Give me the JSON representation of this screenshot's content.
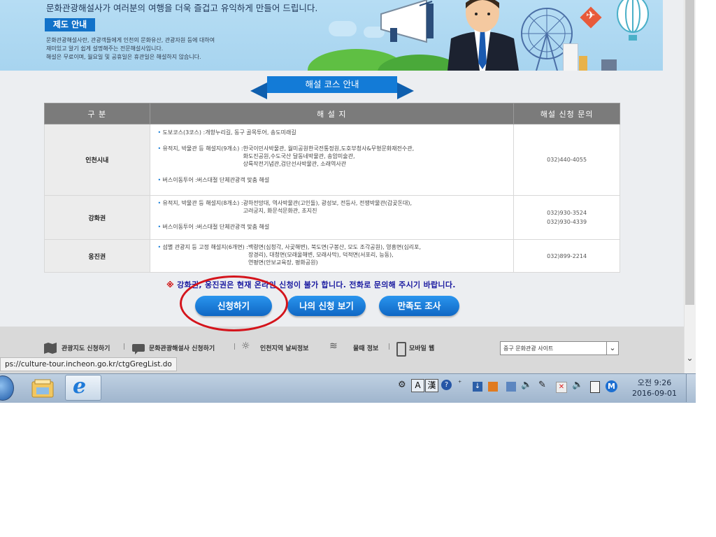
{
  "hero": {
    "tagline": "문화관광해설사가 여러분의 여행을 더욱 즐겁고 유익하게 만들어 드립니다.",
    "badge": "제도 안내",
    "desc_line1": "문화관광해설사란, 관광객들에게 인천의 문화유산, 관광자원 등에 대하여",
    "desc_line2": "재미있고 알기 쉽게 설명해주는 전문해설사입니다.",
    "desc_line3": "해설은 무료이며, 월요일 및 공휴일은 휴관일은 해설하지 않습니다."
  },
  "course_banner": "해설 코스 안내",
  "table": {
    "headers": [
      "구 분",
      "해 설 지",
      "해설 신청 문의"
    ],
    "rows": [
      {
        "region": "인천시내",
        "lines": [
          {
            "label": "도보코스(3코스) : ",
            "details": "개항누리길, 동구 골목투어, 송도미래길"
          },
          {
            "label": "유적지, 박물관 등 해설지(9개소) : ",
            "details": "한국이민사박물관, 월미공원한국전통정원,도호부청사&무형문화재전수관,\n화도진공원,수도국산 달동네박물관, 송암미술관,\n상륙작전기념관,검단선사박물관, 소래역사관"
          },
          {
            "label": "버스이동투어 : ",
            "details": "버스대절 단체관광객 맞춤 해설"
          }
        ],
        "phone": [
          "032)440-4055"
        ]
      },
      {
        "region": "강화권",
        "lines": [
          {
            "label": "유적지, 박물관 등 해설지(8개소) : ",
            "details": "광하전망대, 역사박물관(고인돌), 광성보, 전등사, 전쟁박물관(갑곶돈대),\n고려궁지, 화문석문화관, 초지진"
          },
          {
            "label": "버스이동투어 : ",
            "details": "버스대절 단체관광객 맞춤 해설"
          }
        ],
        "phone": [
          "032)930-3524",
          "032)930-4339"
        ]
      },
      {
        "region": "옹진권",
        "lines": [
          {
            "label": "섬별 관광지 등 고정 해설지(6개면) : ",
            "details": "백령면(심청각, 사곶해변), 북도면(구봉산, 모도 조각공원), 영흥면(십리포,\n장경리), 대청면(모래울해변, 모래사막), 덕적면(서포리, 능동),\n연평면(안보교육장, 평화공원)"
          }
        ],
        "phone": [
          "032)899-2214"
        ]
      }
    ]
  },
  "notice": {
    "star": "※",
    "text": "강화권, 옹진권은 현재 온라인 신청이 불가 합니다. 전화로 문의해 주시기 바랍니다."
  },
  "buttons": {
    "apply": "신청하기",
    "my_apply": "나의 신청 보기",
    "survey": "만족도 조사"
  },
  "footer": {
    "links": [
      "관광지도 신청하기",
      "문화관광해설사 신청하기",
      "인천지역 날씨정보",
      "물때 정보",
      "모바일 웹"
    ],
    "select_value": "중구 문화관광 사이트"
  },
  "status_url": "ps://culture-tour.incheon.go.kr/ctgGregList.do",
  "tray": {
    "ime_a": "A",
    "ime_han": "漢",
    "time": "오전 9:26",
    "date": "2016-09-01"
  },
  "colors": {
    "accent": "#137bd7",
    "highlight": "#d4141c"
  }
}
